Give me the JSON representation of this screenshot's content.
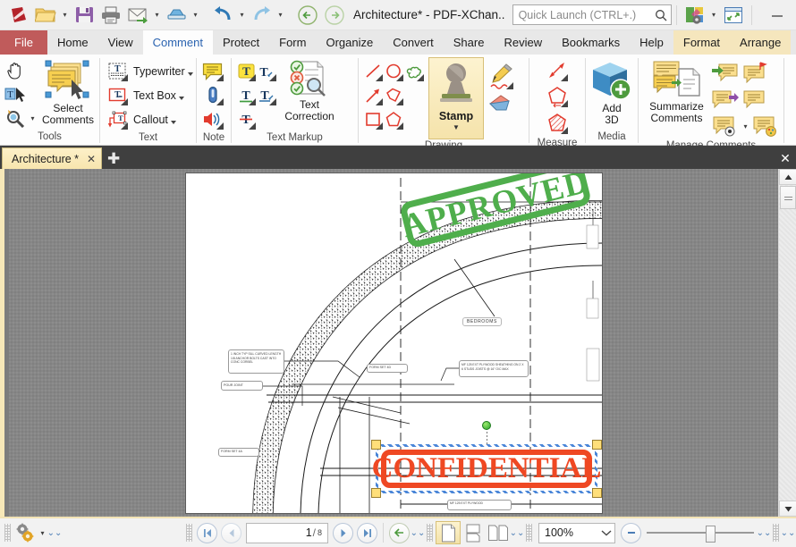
{
  "titlebar": {
    "app_icon": "pdf-xchange-logo-icon",
    "buttons": [
      {
        "name": "open-file-button",
        "icon": "folder-open-icon",
        "label": "Open",
        "has_caret": true
      },
      {
        "name": "save-button",
        "icon": "floppy-save-icon",
        "label": "Save",
        "has_caret": false
      },
      {
        "name": "print-button",
        "icon": "printer-icon",
        "label": "Print",
        "has_caret": false
      },
      {
        "name": "email-button",
        "icon": "envelope-mail-icon",
        "label": "Email",
        "has_caret": true
      },
      {
        "name": "scan-button",
        "icon": "scanner-icon",
        "label": "Scan",
        "has_caret": true
      },
      {
        "name": "undo-button",
        "icon": "undo-arrow-icon",
        "label": "Undo",
        "has_caret": true
      },
      {
        "name": "redo-button",
        "icon": "redo-arrow-icon",
        "label": "Redo",
        "has_caret": true
      },
      {
        "name": "back-button",
        "icon": "back-circle-arrow-icon",
        "label": "Back",
        "has_caret": false
      },
      {
        "name": "forward-button",
        "icon": "forward-circle-arrow-icon",
        "label": "Forward",
        "has_caret": false
      }
    ],
    "title": "Architecture* - PDF-XChan..",
    "quick_launch_placeholder": "Quick Launch (CTRL+.)",
    "quick_launch_value": "",
    "search_icon": "magnifier-icon",
    "theme_button": "theme-palette-gear-icon",
    "fullscreen_button": "fullscreen-expand-icon",
    "minimize": "minimize-icon",
    "maximize": "maximize-icon",
    "close": "close-icon"
  },
  "menubar": {
    "file_label": "File",
    "tabs": [
      {
        "label": "Home",
        "active": false
      },
      {
        "label": "View",
        "active": false
      },
      {
        "label": "Comment",
        "active": true
      },
      {
        "label": "Protect",
        "active": false
      },
      {
        "label": "Form",
        "active": false
      },
      {
        "label": "Organize",
        "active": false
      },
      {
        "label": "Convert",
        "active": false
      },
      {
        "label": "Share",
        "active": false
      },
      {
        "label": "Review",
        "active": false
      },
      {
        "label": "Bookmarks",
        "active": false
      },
      {
        "label": "Help",
        "active": false
      }
    ],
    "context_tabs": [
      {
        "label": "Format"
      },
      {
        "label": "Arrange"
      }
    ],
    "right_icons": [
      {
        "name": "find-document-icon"
      },
      {
        "name": "find-folder-icon"
      }
    ],
    "collapse_ribbon": "chevron-up-icon"
  },
  "ribbon": {
    "groups": [
      {
        "name": "tools",
        "label": "Tools",
        "tool_icons": [
          {
            "name": "hand-tool-icon"
          },
          {
            "name": "select-text-tool-icon"
          },
          {
            "name": "zoom-tool-icon",
            "has_caret": true
          }
        ],
        "big_button": {
          "name": "select-comments-button",
          "label": "Select\nComments",
          "line1": "Select",
          "line2": "Comments",
          "icon": "select-comments-icon"
        }
      },
      {
        "name": "text",
        "label": "Text",
        "items": [
          {
            "name": "typewriter-button",
            "label": "Typewriter",
            "icon": "typewriter-icon",
            "has_caret": true
          },
          {
            "name": "text-box-button",
            "label": "Text Box",
            "icon": "text-box-icon",
            "has_caret": true
          },
          {
            "name": "callout-button",
            "label": "Callout",
            "icon": "callout-icon",
            "has_caret": true
          }
        ]
      },
      {
        "name": "note",
        "label": "Note",
        "items": [
          {
            "name": "sticky-note-button",
            "icon": "sticky-note-icon",
            "has_caret": true
          },
          {
            "name": "file-attachment-button",
            "icon": "paperclip-attachment-icon",
            "has_caret": true
          },
          {
            "name": "sound-attachment-button",
            "icon": "speaker-sound-icon",
            "has_caret": true
          }
        ]
      },
      {
        "name": "text-markup",
        "label": "Text Markup",
        "items": [
          {
            "name": "highlight-text-button",
            "icon": "highlight-t-icon",
            "has_caret": true
          },
          {
            "name": "replace-text-button",
            "icon": "replace-text-icon",
            "has_caret": true
          },
          {
            "name": "underline-text-button",
            "icon": "underline-t-icon",
            "has_caret": true
          },
          {
            "name": "insert-text-button",
            "icon": "insert-caret-text-icon",
            "has_caret": true
          },
          {
            "name": "strikeout-text-button",
            "icon": "strikeout-t-icon",
            "has_caret": true
          }
        ],
        "big_button": {
          "name": "text-correction-button",
          "line1": "Text",
          "line2": "Correction",
          "icon": "text-correction-icon"
        }
      },
      {
        "name": "drawing",
        "label": "Drawing",
        "items": [
          {
            "name": "line-tool-button",
            "icon": "line-icon",
            "has_caret": true
          },
          {
            "name": "ellipse-tool-button",
            "icon": "circle-icon",
            "has_caret": true
          },
          {
            "name": "cloud-tool-button",
            "icon": "cloud-shape-icon",
            "has_caret": true
          },
          {
            "name": "arrow-tool-button",
            "icon": "arrow-icon",
            "has_caret": true
          },
          {
            "name": "polyline-tool-button",
            "icon": "polyline-icon",
            "has_caret": true
          },
          {
            "name": "rectangle-tool-button",
            "icon": "rectangle-icon",
            "has_caret": true
          },
          {
            "name": "polygon-tool-button",
            "icon": "polygon-icon",
            "has_caret": true
          }
        ],
        "stamp_button": {
          "name": "stamp-button",
          "label": "Stamp",
          "icon": "stamp-icon"
        },
        "right_items": [
          {
            "name": "pencil-tool-button",
            "icon": "pencil-icon",
            "has_caret": true
          },
          {
            "name": "eraser-tool-button",
            "icon": "eraser-icon",
            "has_caret": false
          }
        ]
      },
      {
        "name": "measure",
        "label": "Measure",
        "items": [
          {
            "name": "distance-measure-button",
            "icon": "distance-arrow-icon",
            "has_caret": true
          },
          {
            "name": "perimeter-measure-button",
            "icon": "perimeter-icon",
            "has_caret": true
          },
          {
            "name": "area-measure-button",
            "icon": "area-hatch-icon",
            "has_caret": true
          }
        ]
      },
      {
        "name": "media",
        "label": "Media",
        "big_button": {
          "name": "add-3d-button",
          "line1": "Add",
          "line2": "3D",
          "icon": "add-3d-cube-icon"
        }
      },
      {
        "name": "manage-comments",
        "label": "Manage Comments",
        "big_button": {
          "name": "summarize-comments-button",
          "line1": "Summarize",
          "line2": "Comments",
          "icon": "summarize-comments-icon"
        },
        "items": [
          {
            "name": "import-comments-button",
            "icon": "import-comments-icon"
          },
          {
            "name": "flag-comments-button",
            "icon": "flag-comment-icon"
          },
          {
            "name": "export-comments-button",
            "icon": "export-comments-icon"
          },
          {
            "name": "reply-comment-button",
            "icon": "reply-comment-icon"
          },
          {
            "name": "show-comments-button",
            "icon": "show-comments-icon",
            "has_caret": true
          },
          {
            "name": "comment-styles-button",
            "icon": "comment-palette-icon"
          }
        ]
      }
    ]
  },
  "doctabs": {
    "tabs": [
      {
        "name": "document-tab-architecture",
        "label": "Architecture *",
        "close_icon": "close-icon",
        "active": true
      }
    ],
    "new_tab_icon": "plus-icon",
    "close_all_icon": "close-icon"
  },
  "document": {
    "page_content": {
      "approved_stamp": {
        "text": "APPROVED",
        "color": "#4fae4c"
      },
      "confidential_stamp": {
        "text": "CONFIDENTIAL",
        "color": "#ef4823",
        "selected": true
      },
      "labels": [
        {
          "name": "bedrooms-label",
          "text": "BEDROOMS"
        },
        {
          "name": "callout-note-1",
          "text": "1 INCH TYP SILL CURVED LENGTH 1/8 ANCHOR BOLTS CAST INTO CONC CORBEL"
        },
        {
          "name": "callout-note-2",
          "text": "POUR JOINT"
        },
        {
          "name": "callout-note-3",
          "text": "MF 125 EXT PLYWOOD SHEATHING ON 2 X 6 STUDS JOISTS @ 16\" O/C MAX"
        },
        {
          "name": "callout-note-4",
          "text": "FORM SET 4D"
        },
        {
          "name": "callout-note-5",
          "text": "FORM SET 4A"
        },
        {
          "name": "callout-note-6",
          "text": "MF 125 EXT PLYWOOD"
        }
      ]
    },
    "selection_handles": {
      "corner_color": "#ffdf7a",
      "rotate_handle_color": "#2aa32a"
    }
  },
  "scrollbar": {
    "up_icon": "scroll-up-arrow-icon",
    "down_icon": "scroll-down-arrow-icon",
    "thumb": "scroll-thumb"
  },
  "statusbar": {
    "settings_icon": "gears-settings-icon",
    "settings_caret": "chevron-down-icon",
    "expand_icon": "double-chevron-down-icon",
    "first_page_icon": "first-page-icon",
    "prev_page_icon": "previous-page-icon",
    "current_page": "1",
    "page_separator": "/",
    "total_pages": "8",
    "next_page_icon": "next-page-icon",
    "last_page_icon": "last-page-icon",
    "back_nav_icon": "back-circle-arrow-icon",
    "view_modes": [
      {
        "name": "single-page-view-button",
        "icon": "single-page-icon",
        "selected": true
      },
      {
        "name": "continuous-view-button",
        "icon": "continuous-page-icon",
        "selected": false
      },
      {
        "name": "two-page-view-button",
        "icon": "two-page-icon",
        "selected": false
      }
    ],
    "zoom_value": "100%",
    "zoom_caret": "chevron-down-icon",
    "zoom_out_icon": "zoom-out-circle-icon",
    "zoom_slider_icon": "zoom-slider",
    "more_icon": "double-chevron-down-icon"
  },
  "colors": {
    "file_tab": "#c05b5b",
    "active_tab_text": "#2a63b0",
    "context_tab_bg": "#f5e6bd",
    "approved_green": "#4fae4c",
    "confidential_red": "#ef4823",
    "tabbar_bg": "#3f3f3f",
    "rail_yellow": "#f7e8b8"
  }
}
